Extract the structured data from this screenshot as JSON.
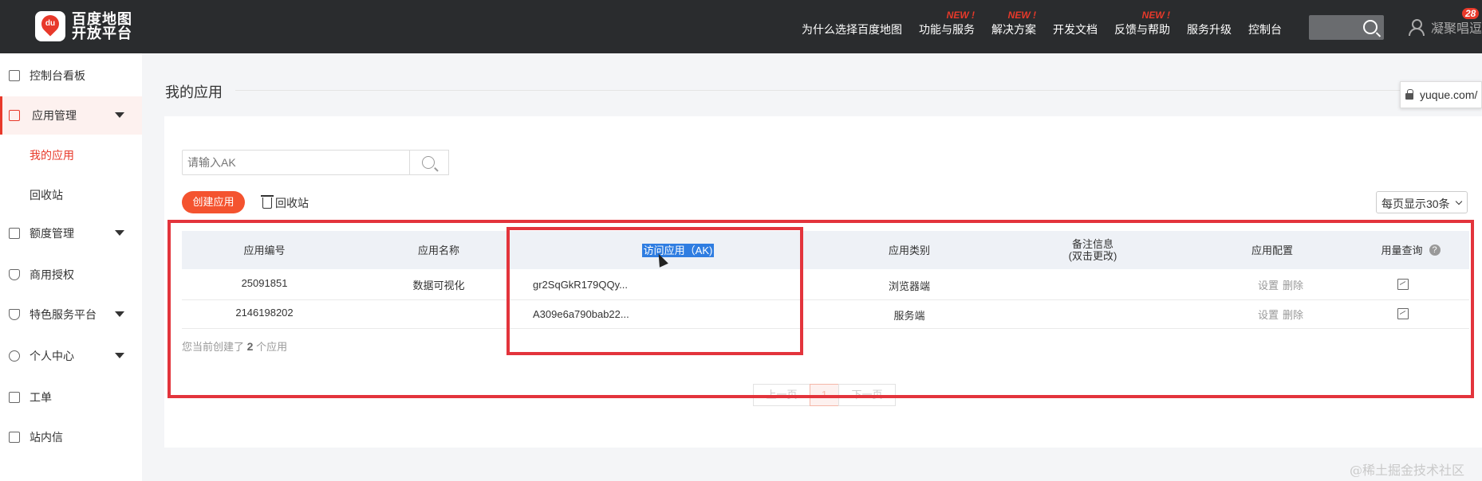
{
  "topbar": {
    "logo_line1": "百度地图",
    "logo_line2": "开放平台",
    "logo_badge": "du",
    "nav": [
      {
        "label": "为什么选择百度地图",
        "new": ""
      },
      {
        "label": "功能与服务",
        "new": "NEW !"
      },
      {
        "label": "解决方案",
        "new": "NEW !"
      },
      {
        "label": "开发文档",
        "new": ""
      },
      {
        "label": "反馈与帮助",
        "new": "NEW !"
      },
      {
        "label": "服务升级",
        "new": ""
      },
      {
        "label": "控制台",
        "new": ""
      }
    ],
    "user_name": "凝聚唱逗",
    "notification_count": "28"
  },
  "sidebar": {
    "items": [
      {
        "label": "控制台看板"
      },
      {
        "label": "应用管理"
      },
      {
        "label": "额度管理"
      },
      {
        "label": "商用授权"
      },
      {
        "label": "特色服务平台"
      },
      {
        "label": "个人中心"
      },
      {
        "label": "工单"
      },
      {
        "label": "站内信"
      }
    ],
    "subitems": [
      {
        "label": "我的应用"
      },
      {
        "label": "回收站"
      }
    ]
  },
  "main": {
    "title": "我的应用",
    "search_placeholder": "请输入AK",
    "create_button": "创建应用",
    "recycle_link": "回收站",
    "page_size": "每页显示30条",
    "columns": [
      "应用编号",
      "应用名称",
      "访问应用（AK)",
      "应用类别",
      "备注信息",
      "(双击更改)",
      "应用配置",
      "用量查询"
    ],
    "rows": [
      {
        "id": "25091851",
        "name": "数据可视化",
        "ak": "gr2SqGkR179QQy...",
        "category": "浏览器端",
        "note": "",
        "config_set": "设置",
        "config_delete": "删除"
      },
      {
        "id": "2146198202",
        "name": "",
        "ak": "A309e6a790bab22...",
        "category": "服务端",
        "note": "",
        "config_set": "设置",
        "config_delete": "删除"
      }
    ],
    "summary_prefix": "您当前创建了",
    "summary_count": "2",
    "summary_suffix": "个应用",
    "pager": {
      "prev": "上一页",
      "current": "1",
      "next": "下一页"
    }
  },
  "browser": {
    "url": "yuque.com/"
  },
  "watermark": "@稀土掘金技术社区",
  "colors": {
    "accent": "#f4532f",
    "annotation": "#e3343c",
    "selection": "#2f7de1"
  }
}
